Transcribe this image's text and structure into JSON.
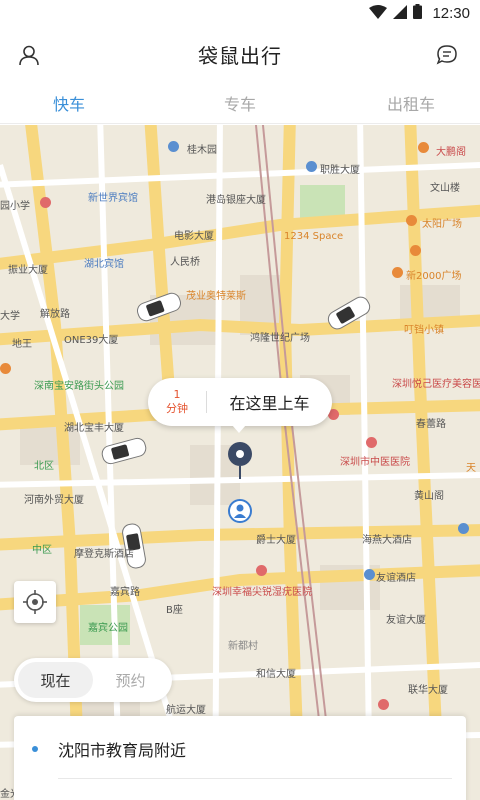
{
  "status_bar": {
    "time": "12:30"
  },
  "header": {
    "title": "袋鼠出行",
    "left_icon": "user-icon",
    "right_icon": "chat-icon"
  },
  "tabs": [
    {
      "label": "快车",
      "active": true
    },
    {
      "label": "专车",
      "active": false
    },
    {
      "label": "出租车",
      "active": false
    }
  ],
  "map": {
    "labels": [
      "桂木园",
      "大鹏阁",
      "职胜大厦",
      "文山楼",
      "新世界宾馆",
      "港岛银座大厦",
      "园小学",
      "电影大厦",
      "1234 Space",
      "太阳广场",
      "振业大厦",
      "湖北宾馆",
      "人民桥",
      "新2000广场",
      "茂业奥特莱斯",
      "叮铛小镇",
      "ONE39大厦",
      "鸿隆世纪广场",
      "大学",
      "解放路",
      "地王",
      "深南宝安路街头公园",
      "深圳悦己医疗美容医院",
      "湖北宝丰大厦",
      "深圳市中医医院",
      "北区",
      "春蕾路",
      "河南外贸大厦",
      "黄山阁",
      "中区",
      "摩登克斯酒店",
      "爵士大厦",
      "海燕大酒店",
      "深圳幸福尖锐湿疣医院",
      "友谊酒店",
      "嘉宾路",
      "嘉宾公园",
      "B座",
      "友谊大厦",
      "新都村",
      "和信大厦",
      "联华大厦",
      "航运大厦",
      "金光华",
      "天",
      "嘉宾路"
    ]
  },
  "pickup": {
    "eta_number": "1",
    "eta_unit": "分钟",
    "text": "在这里上车"
  },
  "time_toggle": {
    "now": "现在",
    "reserve": "预约"
  },
  "address": {
    "pickup_location": "沈阳市教育局附近"
  },
  "colors": {
    "accent": "#3a8fd8",
    "eta": "#e4522e",
    "map_bg": "#efeadd",
    "road_major": "#f7d77e"
  }
}
